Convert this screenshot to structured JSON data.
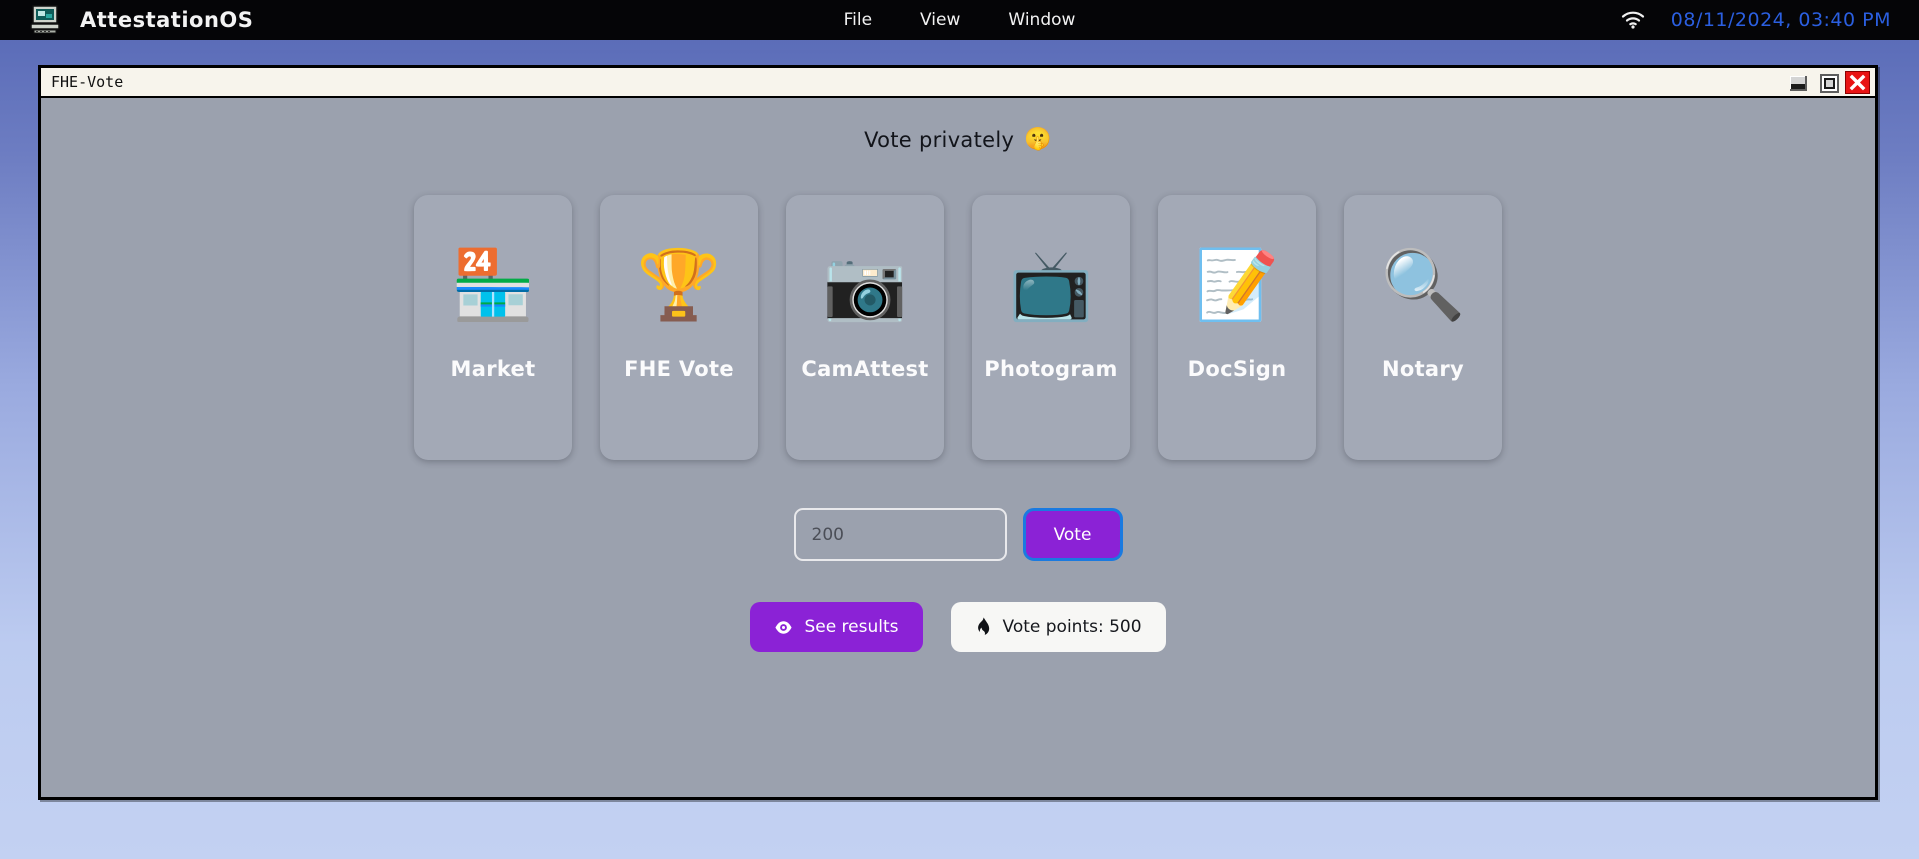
{
  "menubar": {
    "brand": {
      "icon": "computer-icon",
      "title": "AttestationOS"
    },
    "menus": [
      {
        "label": "File"
      },
      {
        "label": "View"
      },
      {
        "label": "Window"
      }
    ],
    "tray": {
      "wifi_icon": "wifi-icon",
      "clock": "08/11/2024, 03:40 PM",
      "clock_color": "#2b5fe0"
    }
  },
  "window": {
    "title": "FHE-Vote",
    "controls": {
      "minimize": "minimize-button",
      "maximize": "maximize-button",
      "close": "close-button",
      "close_color": "#e81313"
    }
  },
  "content": {
    "headline": "Vote privately",
    "headline_emoji": "🤫",
    "apps": [
      {
        "label": "Market",
        "emoji": "🏪",
        "icon": "convenience-store-icon"
      },
      {
        "label": "FHE Vote",
        "emoji": "🏆",
        "icon": "trophy-icon"
      },
      {
        "label": "CamAttest",
        "emoji": "📷",
        "icon": "camera-icon"
      },
      {
        "label": "Photogram",
        "emoji": "📺",
        "icon": "television-icon"
      },
      {
        "label": "DocSign",
        "emoji": "📝",
        "icon": "memo-icon"
      },
      {
        "label": "Notary",
        "emoji": "🔍",
        "icon": "magnifying-glass-icon"
      }
    ],
    "vote": {
      "input_value": "200",
      "input_placeholder": "200",
      "button_label": "Vote",
      "button_color": "#8b22d6",
      "focus_ring_color": "#1a7ae0"
    },
    "actions": {
      "see_results_label": "See results",
      "see_results_icon": "eye-icon",
      "vote_points_label": "Vote points: 500",
      "vote_points_icon": "fire-icon"
    }
  }
}
